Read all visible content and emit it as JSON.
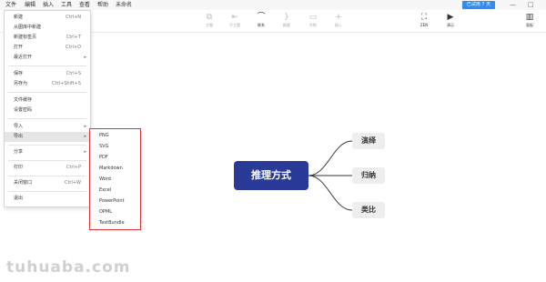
{
  "menubar": {
    "items": [
      "文件",
      "编辑",
      "插入",
      "工具",
      "查看",
      "帮助",
      "未命名"
    ],
    "trial_badge": "已试用 7 天",
    "minimize": "—",
    "maximize": "□"
  },
  "toolbar": {
    "items": [
      {
        "icon": "topic-icon",
        "glyph": "⧉",
        "label": "主题"
      },
      {
        "icon": "subtopic-icon",
        "glyph": "⇤",
        "label": "子主题"
      },
      {
        "icon": "relation-icon",
        "glyph": "⌒",
        "label": "联系"
      },
      {
        "icon": "summary-icon",
        "glyph": "}",
        "label": "概要"
      },
      {
        "icon": "boundary-icon",
        "glyph": "▭",
        "label": "外框"
      },
      {
        "icon": "insert-icon",
        "glyph": "+",
        "label": "插入"
      },
      {
        "icon": "zen-icon",
        "glyph": "⛶",
        "label": "ZEN"
      },
      {
        "icon": "present-icon",
        "glyph": "▶",
        "label": "演示"
      },
      {
        "icon": "panel-icon",
        "glyph": "▥",
        "label": "面板"
      }
    ]
  },
  "file_menu": {
    "groups": [
      [
        {
          "label": "新建",
          "shortcut": "Ctrl+N"
        },
        {
          "label": "从图库中新建",
          "shortcut": ""
        },
        {
          "label": "新建标签页",
          "shortcut": "Ctrl+T"
        },
        {
          "label": "打开",
          "shortcut": "Ctrl+O"
        },
        {
          "label": "最近打开",
          "shortcut": "",
          "submenu": true
        }
      ],
      [
        {
          "label": "保存",
          "shortcut": "Ctrl+S"
        },
        {
          "label": "另存为",
          "shortcut": "Ctrl+Shift+S"
        }
      ],
      [
        {
          "label": "文件缓存",
          "shortcut": ""
        },
        {
          "label": "设置密码",
          "shortcut": ""
        }
      ],
      [
        {
          "label": "导入",
          "shortcut": "",
          "submenu": true
        },
        {
          "label": "导出",
          "shortcut": "",
          "submenu": true,
          "highlighted": true
        }
      ],
      [
        {
          "label": "分享",
          "shortcut": "",
          "submenu": true
        }
      ],
      [
        {
          "label": "打印",
          "shortcut": "Ctrl+P"
        }
      ],
      [
        {
          "label": "关闭窗口",
          "shortcut": "Ctrl+W"
        }
      ],
      [
        {
          "label": "退出",
          "shortcut": ""
        }
      ]
    ],
    "submenu_arrow": "▸"
  },
  "export_submenu": {
    "items": [
      "PNG",
      "SVG",
      "PDF",
      "Markdown",
      "Word",
      "Excel",
      "PowerPoint",
      "OPML",
      "TextBundle"
    ],
    "highlight_color": "#e03030"
  },
  "mindmap": {
    "central": "推理方式",
    "central_color": "#2a3a97",
    "topics": [
      "演绎",
      "归纳",
      "类比"
    ]
  },
  "watermark": "tuhuaba.com"
}
